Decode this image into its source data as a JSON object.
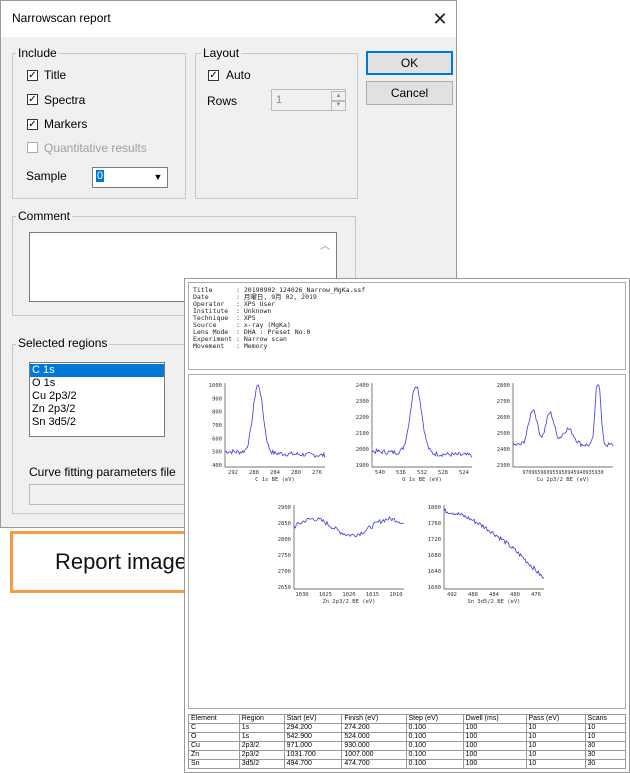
{
  "dialog": {
    "title": "Narrowscan report",
    "close_glyph": "✕",
    "include": {
      "legend": "Include",
      "items": [
        {
          "label": "Title",
          "checked": true,
          "enabled": true
        },
        {
          "label": "Spectra",
          "checked": true,
          "enabled": true
        },
        {
          "label": "Markers",
          "checked": true,
          "enabled": true
        },
        {
          "label": "Quantitative results",
          "checked": false,
          "enabled": false
        }
      ],
      "sample_label": "Sample",
      "sample_value": "0"
    },
    "layout": {
      "legend": "Layout",
      "auto_label": "Auto",
      "auto_checked": true,
      "rows_label": "Rows",
      "rows_value": "1"
    },
    "ok_label": "OK",
    "cancel_label": "Cancel",
    "comment_legend": "Comment",
    "comment_value": "",
    "selected_regions": {
      "legend": "Selected regions",
      "items": [
        "C 1s",
        "O 1s",
        "Cu 2p3/2",
        "Zn 2p3/2",
        "Sn 3d5/2"
      ],
      "selected_index": 0
    },
    "curve_fitting_label": "Curve fitting parameters file",
    "curve_fitting_value": ""
  },
  "callout": {
    "text": "Report image",
    "border_color": "#f39c4a"
  },
  "report": {
    "header_lines": [
      "Title      : 20190902_124026_Narrow_MgKa.ssf",
      "Date       : 月曜日, 9月 02, 2019",
      "Operator   : XPS User",
      "Institute  : Unknown",
      "Technique  : XPS",
      "Source     : x-ray (MgKa)",
      "Lens Mode  : DHA : Preset No.0",
      "Experiment : Narrow scan",
      "Movement   : Memory"
    ],
    "spectra": [
      {
        "name": "C 1s",
        "xlabel": "C 1s  BE (eV)",
        "yticks": [
          "1000",
          "900",
          "800",
          "700",
          "600",
          "500",
          "400"
        ],
        "xticks": [
          "292",
          "288",
          "284",
          "280",
          "276"
        ]
      },
      {
        "name": "O 1s",
        "xlabel": "O 1s  BE (eV)",
        "yticks": [
          "2400",
          "2300",
          "2200",
          "2100",
          "2000",
          "1900"
        ],
        "xticks": [
          "540",
          "536",
          "532",
          "528",
          "524"
        ]
      },
      {
        "name": "Cu 2p3/2",
        "xlabel": "Cu 2p3/2  BE (eV)",
        "yticks": [
          "2800",
          "2700",
          "2600",
          "2500",
          "2400",
          "2300"
        ],
        "xticks": [
          "970965960955950945940935930"
        ]
      },
      {
        "name": "Zn 2p3/2",
        "xlabel": "Zn 2p3/2  BE (eV)",
        "yticks": [
          "2900",
          "2850",
          "2800",
          "2750",
          "2700",
          "2650"
        ],
        "xticks": [
          "1030",
          "1025",
          "1020",
          "1015",
          "1010"
        ]
      },
      {
        "name": "Sn 3d5/2",
        "xlabel": "Sn 3d5/2  BE (eV)",
        "yticks": [
          "1800",
          "1760",
          "1720",
          "1680",
          "1640",
          "1600"
        ],
        "xticks": [
          "492",
          "488",
          "484",
          "480",
          "476"
        ]
      }
    ],
    "table": {
      "headers": [
        "Element",
        "Region",
        "Start (eV)",
        "Finish (eV)",
        "Step (eV)",
        "Dwell (ms)",
        "Pass (eV)",
        "Scans"
      ],
      "rows": [
        [
          "C",
          "1s",
          "294.200",
          "274.200",
          "0.100",
          "100",
          "10",
          "10"
        ],
        [
          "O",
          "1s",
          "542.900",
          "524.000",
          "0.100",
          "100",
          "10",
          "10"
        ],
        [
          "Cu",
          "2p3/2",
          "971.000",
          "930.000",
          "0.100",
          "100",
          "10",
          "30"
        ],
        [
          "Zn",
          "2p3/2",
          "1031.700",
          "1007.000",
          "0.100",
          "100",
          "10",
          "30"
        ],
        [
          "Sn",
          "3d5/2",
          "494.700",
          "474.700",
          "0.100",
          "100",
          "10",
          "30"
        ]
      ]
    },
    "spectrum_color": "#3b3bdc"
  }
}
